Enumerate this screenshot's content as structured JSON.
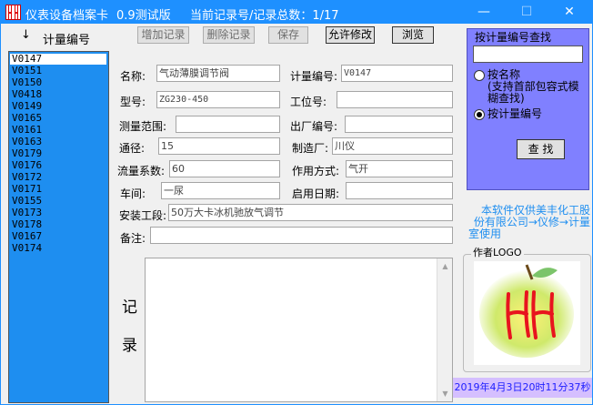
{
  "title_bar": {
    "app_title": "仪表设备档案卡",
    "version": "0.9测试版",
    "record_status": "当前记录号/记录总数：1/17",
    "minimize_glyph": "—",
    "maximize_glyph": "☐",
    "close_glyph": "✕"
  },
  "list_panel": {
    "sort_arrow": "↓",
    "header": "计量编号",
    "items": [
      "V0147",
      "V0151",
      "V0150",
      "V0418",
      "V0149",
      "V0165",
      "V0161",
      "V0163",
      "V0179",
      "V0176",
      "V0172",
      "V0171",
      "V0155",
      "V0173",
      "V0178",
      "V0167",
      "V0174"
    ],
    "selected": "V0147"
  },
  "toolbar": {
    "add": "增加记录",
    "delete": "删除记录",
    "save": "保存",
    "allow_edit": "允许修改",
    "browse": "浏览"
  },
  "form": {
    "name_label": "名称:",
    "name_value": "气动薄膜调节阀",
    "meter_no_label": "计量编号:",
    "meter_no_value": "V0147",
    "model_label": "型号:",
    "model_value": "ZG230-450",
    "position_label": "工位号:",
    "position_value": "",
    "range_label": "测量范围:",
    "range_value": "",
    "factory_no_label": "出厂编号:",
    "factory_no_value": "",
    "diameter_label": "通径:",
    "diameter_value": "15",
    "manufacturer_label": "制造厂:",
    "manufacturer_value": "川仪",
    "flow_coef_label": "流量系数:",
    "flow_coef_value": "60",
    "action_label": "作用方式:",
    "action_value": "气开",
    "workshop_label": "车间:",
    "workshop_value": "一尿",
    "start_date_label": "启用日期:",
    "start_date_value": "",
    "install_label": "安装工段:",
    "install_value": "50万大卡冰机驰放气调节",
    "remark_label": "备注:",
    "remark_value": "",
    "record_label_1": "记",
    "record_label_2": "录"
  },
  "search": {
    "title": "按计量编号查找",
    "input_value": "",
    "option_name_line1": "按名称",
    "option_name_line2": "(支持首部包容式模",
    "option_name_line3": "糊查找)",
    "option_meter": "按计量编号",
    "selected_option": "option_meter",
    "button": "查 找"
  },
  "note": {
    "line1": "本软件仅供美丰化工股",
    "line2": "份有限公司→仪修→计量",
    "line3": "室使用"
  },
  "logo": {
    "label": "作者LOGO",
    "mark_text": "HH"
  },
  "status": {
    "datetime": "2019年4月3日20时11分37秒"
  },
  "colors": {
    "titlebar": "#1e90ff",
    "list_bg": "#1e8ef0",
    "search_panel": "#8080ff",
    "datetime_bg": "#d5bfff",
    "note_text": "#1e8ef0",
    "logo_red": "#e8141e"
  }
}
